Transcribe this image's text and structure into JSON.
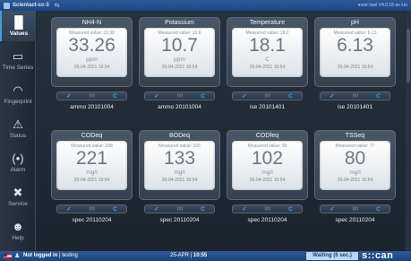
{
  "window": {
    "title": "Scientact-cc-3",
    "version": "moni::tool V4.0.16 en Lin"
  },
  "sidebar": {
    "items": [
      {
        "label": "Values",
        "icon": "bar-chart-icon"
      },
      {
        "label": "Time Series",
        "icon": "time-series-icon"
      },
      {
        "label": "Fingerprint",
        "icon": "fingerprint-icon"
      },
      {
        "label": "Status",
        "icon": "warning-icon"
      },
      {
        "label": "Alarm",
        "icon": "alarm-icon"
      },
      {
        "label": "Service",
        "icon": "tools-icon"
      },
      {
        "label": "Help",
        "icon": "help-icon"
      }
    ]
  },
  "cards": [
    {
      "param": "NH4-N",
      "measured": "Measured value: 33.98",
      "value": "33.26",
      "unit": "ppm",
      "stamp": "25-04-2021 10:54",
      "sensor": "ammo 20101004"
    },
    {
      "param": "Potassium",
      "measured": "Measured value: 10.6",
      "value": "10.7",
      "unit": "ppm",
      "stamp": "25-04-2021 10:54",
      "sensor": "ammo 20101004"
    },
    {
      "param": "Temperature",
      "measured": "Measured value: 18.2",
      "value": "18.1",
      "unit": "C",
      "stamp": "25-04-2021 10:54",
      "sensor": "ise 20101401"
    },
    {
      "param": "pH",
      "measured": "Measured value: 6.13",
      "value": "6.13",
      "unit": "",
      "stamp": "25-04-2021 10:54",
      "sensor": "ise 20101401"
    },
    {
      "param": "CODeq",
      "measured": "Measured value: 208",
      "value": "221",
      "unit": "mg/l",
      "stamp": "25-04-2021 10:54",
      "sensor": "spec 20110204"
    },
    {
      "param": "BODeq",
      "measured": "Measured value: 165",
      "value": "133",
      "unit": "mg/l",
      "stamp": "25-04-2021 10:54",
      "sensor": "spec 20110204"
    },
    {
      "param": "CODfeq",
      "measured": "Measured value: 90",
      "value": "102",
      "unit": "mg/l",
      "stamp": "25-04-2021 10:54",
      "sensor": "spec 20110204"
    },
    {
      "param": "TSSeq",
      "measured": "Measured value: 77",
      "value": "80",
      "unit": "mg/l",
      "stamp": "25-04-2021 10:54",
      "sensor": "spec 20110204"
    }
  ],
  "status_icons": {
    "check": "✓",
    "mid": "(o)",
    "cal": "C"
  },
  "footer": {
    "login_bold": "Not logged in",
    "login_rest": " | testing",
    "date": "25-APR | ",
    "time": "10:55",
    "waiting": "Waiting (6 sec.)",
    "logo": "s::can"
  },
  "colors": {
    "accent": "#3fa9f5",
    "bar": "#1d4680"
  }
}
